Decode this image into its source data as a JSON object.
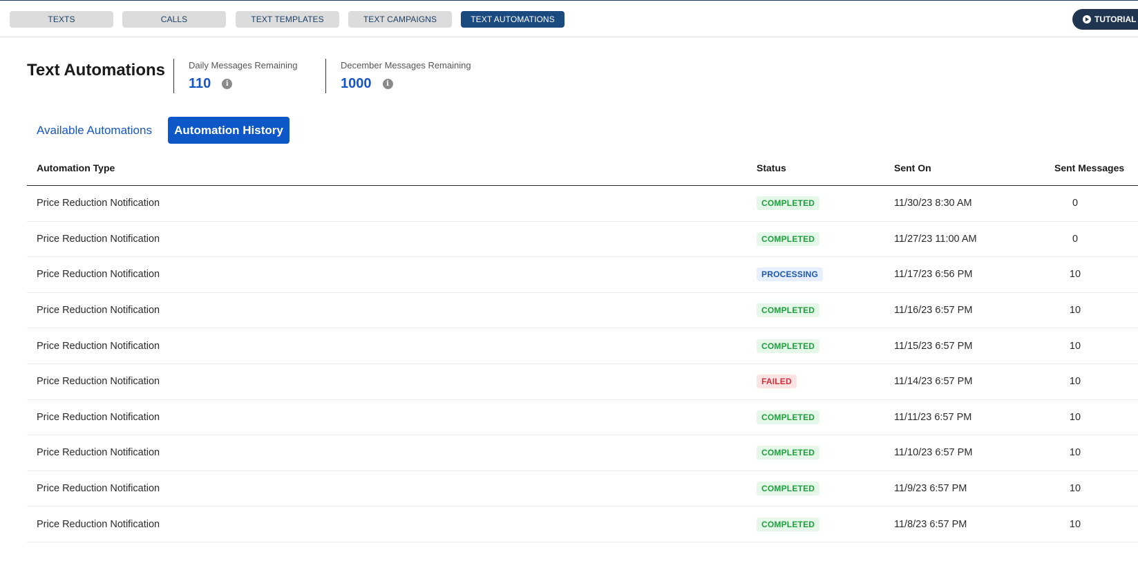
{
  "nav": {
    "tabs": [
      {
        "label": "TEXTS",
        "active": false
      },
      {
        "label": "CALLS",
        "active": false
      },
      {
        "label": "TEXT TEMPLATES",
        "active": false
      },
      {
        "label": "TEXT CAMPAIGNS",
        "active": false
      },
      {
        "label": "TEXT AUTOMATIONS",
        "active": true
      }
    ],
    "tutorial_label": "TUTORIAL V"
  },
  "header": {
    "title": "Text Automations",
    "daily": {
      "label": "Daily Messages Remaining",
      "value": "110"
    },
    "monthly": {
      "label": "December Messages Remaining",
      "value": "1000"
    },
    "info_glyph": "i"
  },
  "subtabs": {
    "available": "Available Automations",
    "history": "Automation History"
  },
  "table": {
    "columns": {
      "type": "Automation Type",
      "status": "Status",
      "sent_on": "Sent On",
      "sent_messages": "Sent Messages"
    },
    "rows": [
      {
        "type": "Price Reduction Notification",
        "status": "COMPLETED",
        "sent_on": "11/30/23 8:30 AM",
        "sent_messages": "0"
      },
      {
        "type": "Price Reduction Notification",
        "status": "COMPLETED",
        "sent_on": "11/27/23 11:00 AM",
        "sent_messages": "0"
      },
      {
        "type": "Price Reduction Notification",
        "status": "PROCESSING",
        "sent_on": "11/17/23 6:56 PM",
        "sent_messages": "10"
      },
      {
        "type": "Price Reduction Notification",
        "status": "COMPLETED",
        "sent_on": "11/16/23 6:57 PM",
        "sent_messages": "10"
      },
      {
        "type": "Price Reduction Notification",
        "status": "COMPLETED",
        "sent_on": "11/15/23 6:57 PM",
        "sent_messages": "10"
      },
      {
        "type": "Price Reduction Notification",
        "status": "FAILED",
        "sent_on": "11/14/23 6:57 PM",
        "sent_messages": "10"
      },
      {
        "type": "Price Reduction Notification",
        "status": "COMPLETED",
        "sent_on": "11/11/23 6:57 PM",
        "sent_messages": "10"
      },
      {
        "type": "Price Reduction Notification",
        "status": "COMPLETED",
        "sent_on": "11/10/23 6:57 PM",
        "sent_messages": "10"
      },
      {
        "type": "Price Reduction Notification",
        "status": "COMPLETED",
        "sent_on": "11/9/23 6:57 PM",
        "sent_messages": "10"
      },
      {
        "type": "Price Reduction Notification",
        "status": "COMPLETED",
        "sent_on": "11/8/23 6:57 PM",
        "sent_messages": "10"
      }
    ]
  },
  "colors": {
    "accent": "#0d57c9",
    "nav_active": "#1b4a80",
    "completed": "#1e9e3d",
    "processing": "#1d57b3",
    "failed": "#d0303a"
  }
}
